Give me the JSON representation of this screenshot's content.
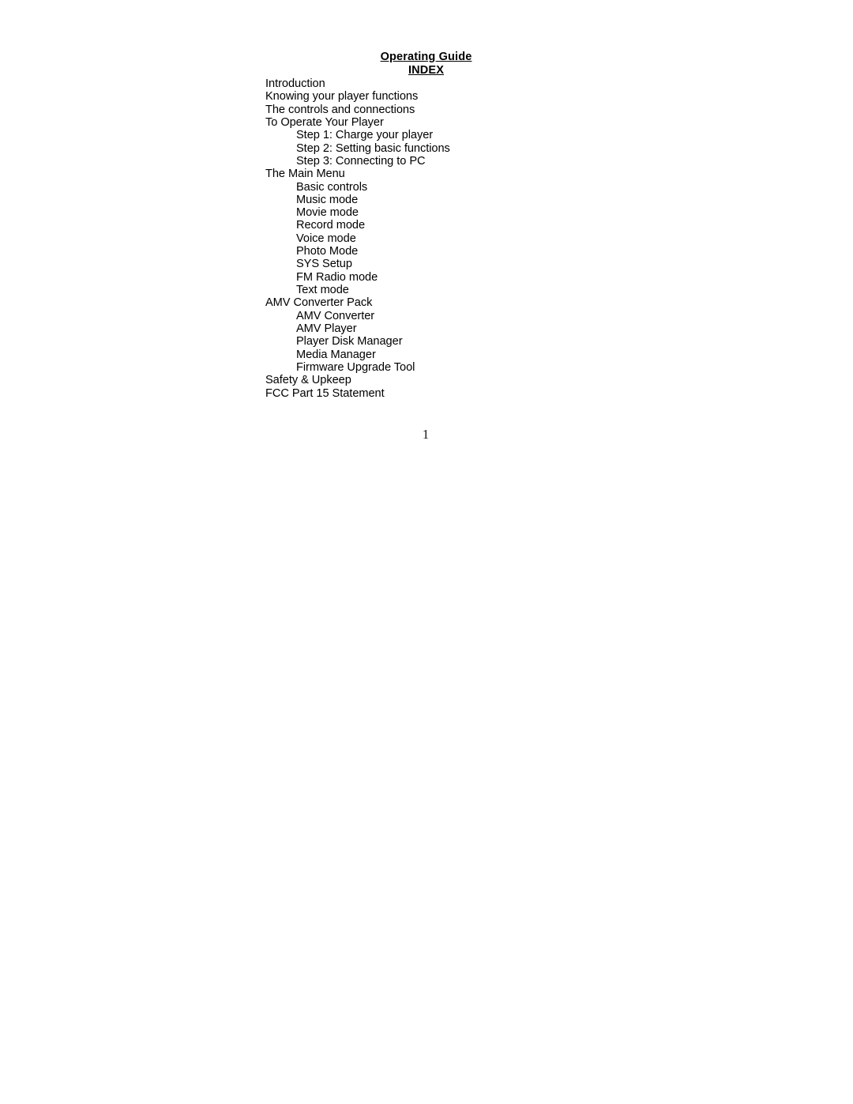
{
  "document": {
    "title": "Operating Guide",
    "subtitle": "INDEX",
    "page_number": "1",
    "text_color": "#000000",
    "background_color": "#ffffff"
  },
  "index": {
    "items": [
      {
        "label": "Introduction",
        "level": 1
      },
      {
        "label": "Knowing your player functions",
        "level": 1
      },
      {
        "label": "The controls and connections",
        "level": 1
      },
      {
        "label": "To Operate Your Player",
        "level": 1
      },
      {
        "label": "Step 1: Charge your player",
        "level": 2
      },
      {
        "label": "Step 2: Setting basic functions",
        "level": 2
      },
      {
        "label": "Step 3: Connecting to PC",
        "level": 2
      },
      {
        "label": "The Main Menu",
        "level": 1
      },
      {
        "label": "Basic controls",
        "level": 2
      },
      {
        "label": "Music mode",
        "level": 2
      },
      {
        "label": "Movie mode",
        "level": 2
      },
      {
        "label": "Record mode",
        "level": 2
      },
      {
        "label": "Voice mode",
        "level": 2
      },
      {
        "label": "Photo Mode",
        "level": 2
      },
      {
        "label": "SYS Setup",
        "level": 2
      },
      {
        "label": "FM Radio mode",
        "level": 2
      },
      {
        "label": "Text mode",
        "level": 2
      },
      {
        "label": "AMV Converter Pack",
        "level": 1
      },
      {
        "label": "AMV Converter",
        "level": 2
      },
      {
        "label": "AMV Player",
        "level": 2
      },
      {
        "label": "Player Disk Manager",
        "level": 2
      },
      {
        "label": "Media Manager",
        "level": 2
      },
      {
        "label": "Firmware Upgrade Tool",
        "level": 2
      },
      {
        "label": "Safety & Upkeep",
        "level": 1
      },
      {
        "label": "FCC Part 15 Statement",
        "level": 1
      }
    ]
  }
}
